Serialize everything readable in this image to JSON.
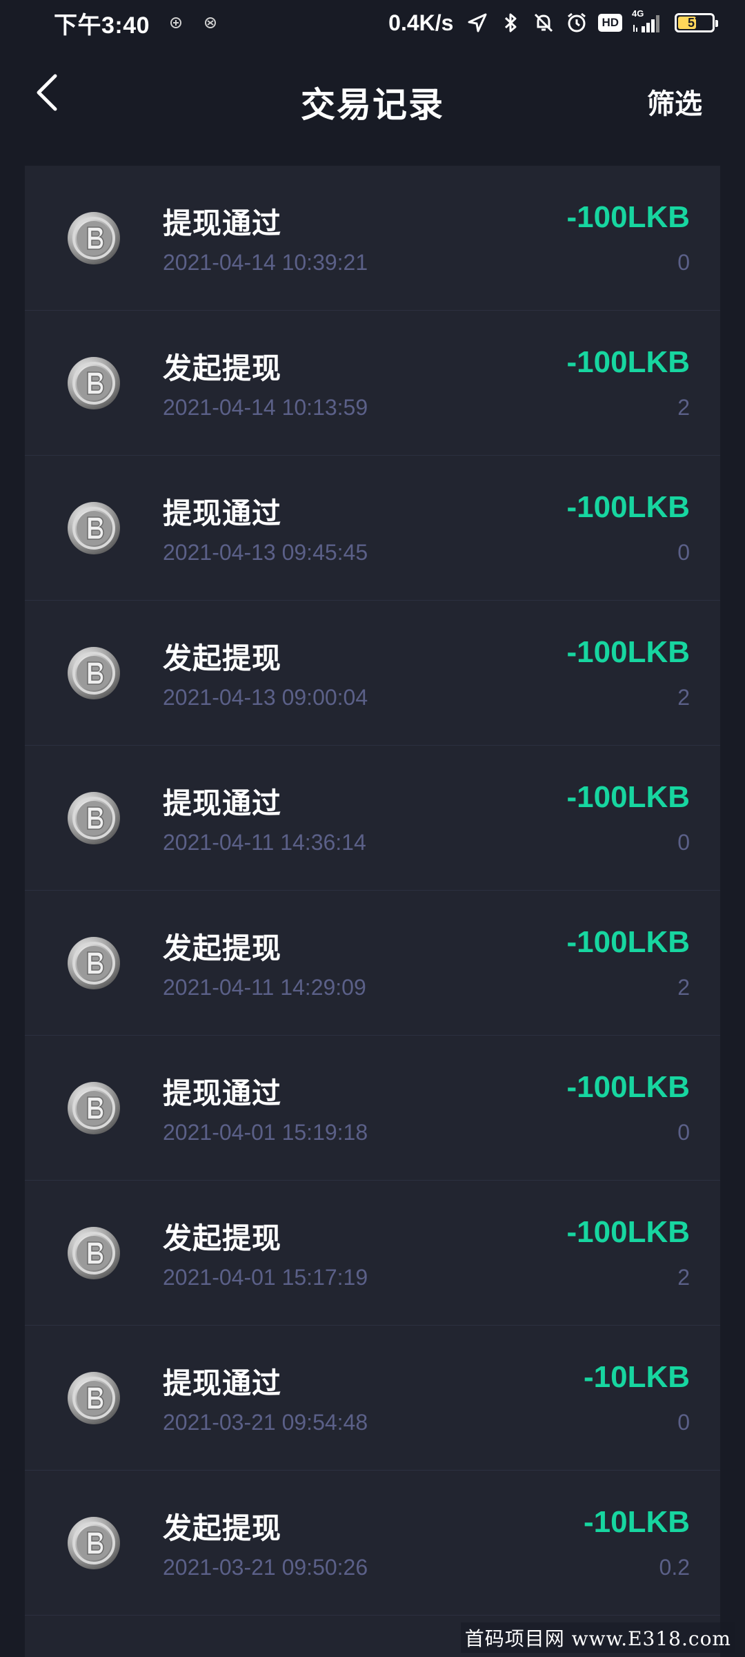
{
  "status_bar": {
    "time": "下午3:40",
    "net_speed": "0.4K/s",
    "hd_label": "HD",
    "network_label": "4G",
    "battery_level": "57"
  },
  "header": {
    "title": "交易记录",
    "filter_label": "筛选"
  },
  "records": [
    {
      "title": "提现通过",
      "time": "2021-04-14 10:39:21",
      "amount": "-100LKB",
      "fee": "0"
    },
    {
      "title": "发起提现",
      "time": "2021-04-14 10:13:59",
      "amount": "-100LKB",
      "fee": "2"
    },
    {
      "title": "提现通过",
      "time": "2021-04-13 09:45:45",
      "amount": "-100LKB",
      "fee": "0"
    },
    {
      "title": "发起提现",
      "time": "2021-04-13 09:00:04",
      "amount": "-100LKB",
      "fee": "2"
    },
    {
      "title": "提现通过",
      "time": "2021-04-11 14:36:14",
      "amount": "-100LKB",
      "fee": "0"
    },
    {
      "title": "发起提现",
      "time": "2021-04-11 14:29:09",
      "amount": "-100LKB",
      "fee": "2"
    },
    {
      "title": "提现通过",
      "time": "2021-04-01 15:19:18",
      "amount": "-100LKB",
      "fee": "0"
    },
    {
      "title": "发起提现",
      "time": "2021-04-01 15:17:19",
      "amount": "-100LKB",
      "fee": "2"
    },
    {
      "title": "提现通过",
      "time": "2021-03-21 09:54:48",
      "amount": "-10LKB",
      "fee": "0"
    },
    {
      "title": "发起提现",
      "time": "2021-03-21 09:50:26",
      "amount": "-10LKB",
      "fee": "0.2"
    }
  ],
  "colors": {
    "background": "#181b25",
    "card": "#222530",
    "amount": "#17d6a0",
    "secondary_text": "#5b6088"
  },
  "watermark": "首码项目网 www.E318.com"
}
